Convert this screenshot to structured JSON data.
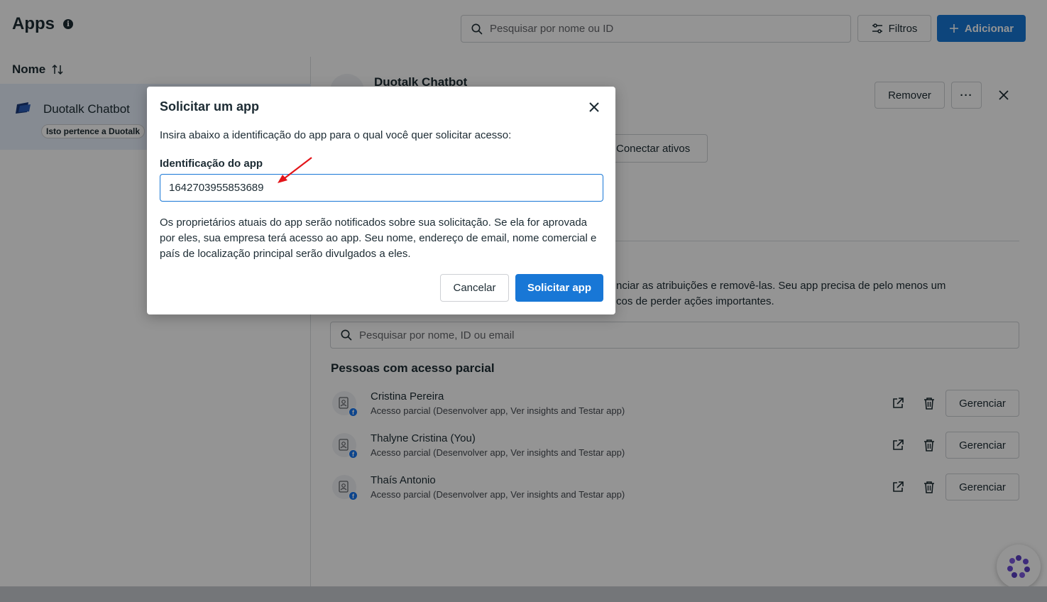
{
  "header": {
    "title": "Apps",
    "search_placeholder": "Pesquisar por nome ou ID",
    "filters_label": "Filtros",
    "add_label": "Adicionar"
  },
  "app_list": {
    "column_header": "Nome",
    "items": [
      {
        "name": "Duotalk Chatbot",
        "badge": "Isto pertence a Duotalk"
      }
    ]
  },
  "detail": {
    "title": "Duotalk Chatbot",
    "remove_label": "Remover",
    "more_label": "···",
    "connect_label": "Conectar ativos",
    "description_line1": "nciar as atribuições e removê-las. Seu app precisa de pelo menos um",
    "description_line2": "cos de perder ações importantes.",
    "people_search_placeholder": "Pesquisar por nome, ID ou email",
    "section_title": "Pessoas com acesso parcial",
    "people": [
      {
        "name": "Cristina Pereira",
        "access": "Acesso parcial (Desenvolver app, Ver insights and Testar app)",
        "manage_label": "Gerenciar"
      },
      {
        "name": "Thalyne Cristina (You)",
        "access": "Acesso parcial (Desenvolver app, Ver insights and Testar app)",
        "manage_label": "Gerenciar"
      },
      {
        "name": "Thaís Antonio",
        "access": "Acesso parcial (Desenvolver app, Ver insights and Testar app)",
        "manage_label": "Gerenciar"
      }
    ]
  },
  "modal": {
    "title": "Solicitar um app",
    "instruction": "Insira abaixo a identificação do app para o qual você quer solicitar acesso:",
    "field_label": "Identificação do app",
    "field_value": "1642703955853689",
    "note": "Os proprietários atuais do app serão notificados sobre sua solicitação. Se ela for aprovada por eles, sua empresa terá acesso ao app. Seu nome, endereço de email, nome comercial e país de localização principal serão divulgados a eles.",
    "cancel_label": "Cancelar",
    "submit_label": "Solicitar app"
  },
  "colors": {
    "primary": "#1877d6",
    "overlay": "rgba(0,0,0,0.42)",
    "selected_row": "#e7f0fb",
    "annotation_arrow": "#e3151a"
  },
  "icons": {
    "title_info": "info-icon",
    "search": "search-icon",
    "filters": "sliders-icon",
    "add": "plus-icon",
    "sort": "sort-arrows-icon",
    "close": "close-icon",
    "open_external": "external-link-icon",
    "delete": "trash-icon",
    "help": "help-bubble-icon"
  }
}
